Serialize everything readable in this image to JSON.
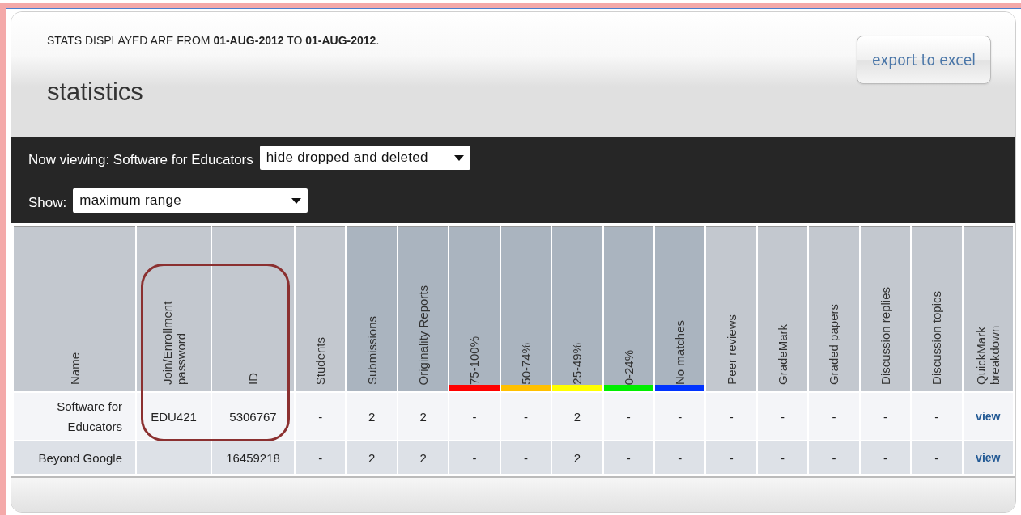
{
  "header": {
    "date_range": "STATS DISPLAYED ARE FROM **01-AUG-2012** TO **01-AUG-2012**.",
    "title": "statistics",
    "export_button": "export to excel"
  },
  "filters": [
    {
      "label": "Now viewing: Software for Educators",
      "value": "hide dropped and deleted"
    },
    {
      "label": "Show:",
      "value": "maximum range"
    }
  ],
  "table": {
    "columns": [
      {
        "label": "Name",
        "kind": "plain"
      },
      {
        "label": "Join/Enrollment password",
        "kind": "plain"
      },
      {
        "label": "ID",
        "kind": "plain"
      },
      {
        "label": "Students",
        "kind": "plain"
      },
      {
        "label": "Submissions",
        "kind": "report"
      },
      {
        "label": "Originality Reports",
        "kind": "report"
      },
      {
        "label": "75-100%",
        "kind": "report",
        "color": "#ff0000"
      },
      {
        "label": "50-74%",
        "kind": "report",
        "color": "#ffc000"
      },
      {
        "label": "25-49%",
        "kind": "report",
        "color": "#ffff00"
      },
      {
        "label": "0-24%",
        "kind": "report",
        "color": "#00ee00"
      },
      {
        "label": "No matches",
        "kind": "report",
        "color": "#0033ff"
      },
      {
        "label": "Peer reviews",
        "kind": "plain"
      },
      {
        "label": "GradeMark",
        "kind": "plain"
      },
      {
        "label": "Graded papers",
        "kind": "plain"
      },
      {
        "label": "Discussion replies",
        "kind": "plain"
      },
      {
        "label": "Discussion topics",
        "kind": "plain"
      },
      {
        "label": "QuickMark breakdown",
        "kind": "plain"
      }
    ],
    "rows": [
      {
        "cells": [
          "Software for Educators",
          "EDU421",
          "5306767",
          "-",
          "2",
          "2",
          "-",
          "-",
          "2",
          "-",
          "-",
          "-",
          "-",
          "-",
          "-",
          "-",
          "view"
        ]
      },
      {
        "cells": [
          "Beyond Google",
          "",
          "16459218",
          "-",
          "2",
          "2",
          "-",
          "-",
          "2",
          "-",
          "-",
          "-",
          "-",
          "-",
          "-",
          "-",
          "view"
        ]
      }
    ]
  }
}
